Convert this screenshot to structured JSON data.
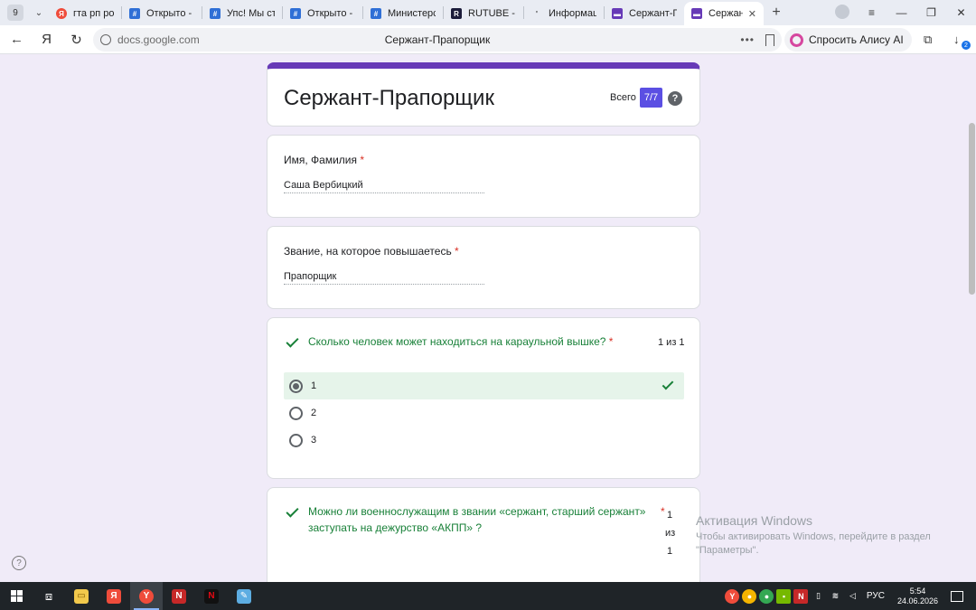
{
  "browser": {
    "tab_count": "9",
    "tabs": [
      {
        "label": "гта рп росси",
        "favicon_color": "#ef4c3b",
        "favicon_glyph": "Я"
      },
      {
        "label": "Открыто - Р",
        "favicon_color": "#2f6fd6",
        "favicon_glyph": "#"
      },
      {
        "label": "Упс! Мы сто",
        "favicon_color": "#2f6fd6",
        "favicon_glyph": "#"
      },
      {
        "label": "Открыто - Р",
        "favicon_color": "#2f6fd6",
        "favicon_glyph": "#"
      },
      {
        "label": "Министерс",
        "favicon_color": "#2f6fd6",
        "favicon_glyph": "#"
      },
      {
        "label": "RUTUBE - сл",
        "favicon_color": "#1c1c3a",
        "favicon_glyph": "R"
      },
      {
        "label": "Информаци",
        "favicon_color": "#ffffff",
        "favicon_glyph": "'"
      },
      {
        "label": "Сержант-Пр",
        "favicon_color": "#673ab7",
        "favicon_glyph": "▬"
      },
      {
        "label": "Сержант",
        "favicon_color": "#673ab7",
        "favicon_glyph": "▬",
        "active": true
      }
    ],
    "url": "docs.google.com",
    "page_title": "Сержант-Прапорщик",
    "alice_button": "Спросить Алису AI",
    "downloads_badge": "2"
  },
  "form": {
    "title": "Сержант-Прапорщик",
    "score_label": "Всего",
    "score_value": "7/7",
    "help_glyph": "?",
    "questions": [
      {
        "title": "Имя, Фамилия",
        "required_mark": "*",
        "answer": "Саша Вербицкий"
      },
      {
        "title": "Звание, на которое повышаетесь",
        "required_mark": "*",
        "answer": "Прапорщик"
      },
      {
        "title": "Сколько человек может находиться на караульной вышке?",
        "required_mark": "*",
        "points": "1 из 1",
        "options": [
          "1",
          "2",
          "3"
        ],
        "selected": "1"
      },
      {
        "title": "Можно ли военнослужащим в звании «сержант, старший сержант» заступать на дежурство «АКПП» ?",
        "required_mark": "*",
        "points_lines": [
          "1",
          "из",
          "1"
        ]
      }
    ]
  },
  "watermark": {
    "title": "Активация Windows",
    "subtitle": "Чтобы активировать Windows, перейдите в раздел \"Параметры\"."
  },
  "taskbar": {
    "language": "РУС",
    "time": "5:54",
    "date": "24.06.2026"
  },
  "colors": {
    "form_accent": "#673ab7",
    "background": "#f0ebf8",
    "correct_green": "#188038",
    "correct_bg": "#e6f4ea",
    "score_badge": "#5b4fe3"
  }
}
